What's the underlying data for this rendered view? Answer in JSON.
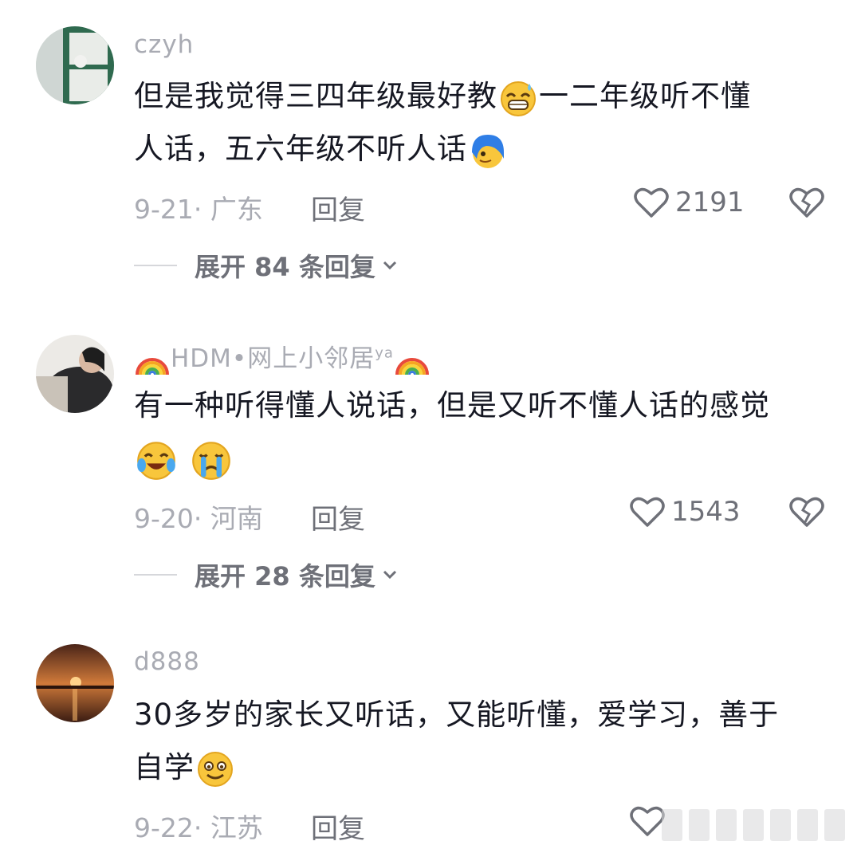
{
  "comments": [
    {
      "username": "czyh",
      "line1": "但是我觉得三四年级最好教",
      "line1b": "一二年级听不懂",
      "line2": "人话，五六年级不听人话",
      "date_location": "9-21· 广东",
      "reply_label": "回复",
      "likes": "2191",
      "expand_label": "展开 84 条回复"
    },
    {
      "username": "HDM•网上小邻居",
      "username_suffix": "ya",
      "line1": "有一种听得懂人说话，但是又听不懂人话的感觉",
      "date_location": "9-20· 河南",
      "reply_label": "回复",
      "likes": "1543",
      "expand_label": "展开 28 条回复"
    },
    {
      "username": "d888",
      "line1": "30多岁的家长又听话，又能听懂，爱学习，善于",
      "line2": "自学",
      "date_location": "9-22· 江苏",
      "reply_label": "回复"
    }
  ],
  "icons": {
    "like": "heart-outline-icon",
    "dislike": "broken-heart-icon",
    "expand": "chevron-down-icon"
  },
  "colors": {
    "text": "#161823",
    "meta": "#a9abb3",
    "action": "#6e7078",
    "emoji_yellow": "#f8c63c"
  }
}
